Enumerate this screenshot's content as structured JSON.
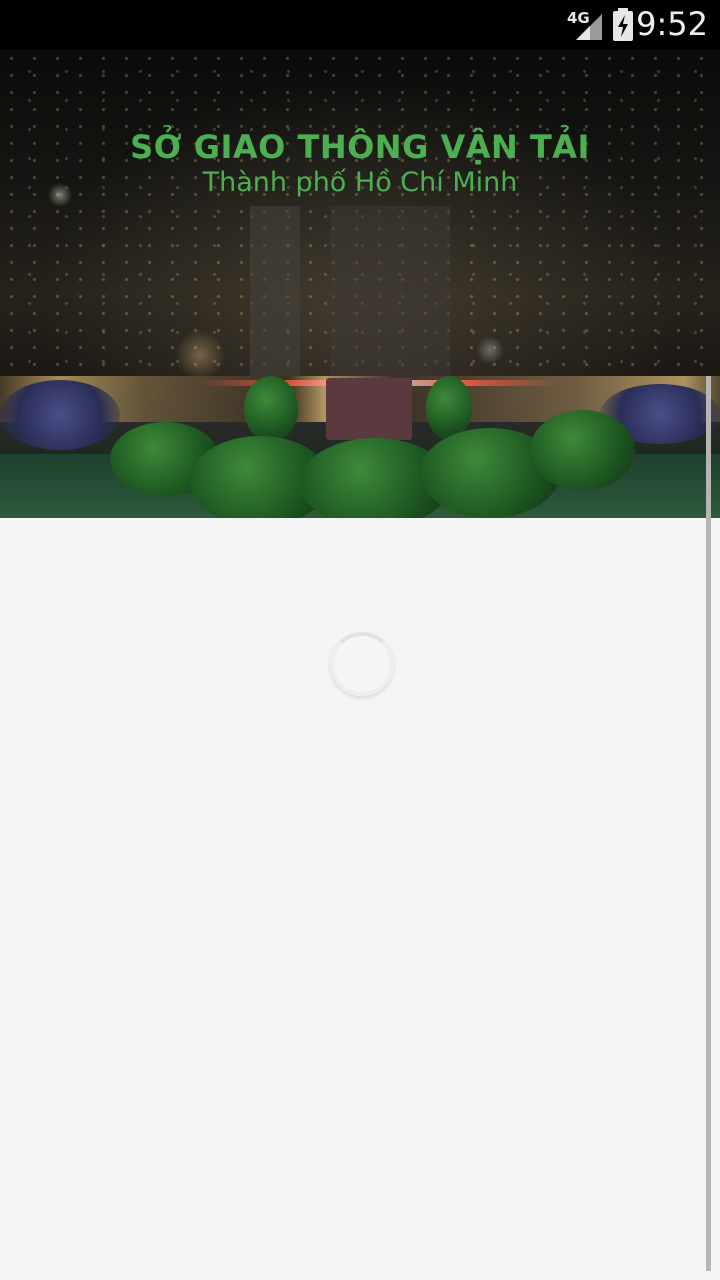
{
  "status_bar": {
    "network": "4G",
    "time": "9:52"
  },
  "header": {
    "title": "SỞ GIAO THÔNG VẬN TẢI",
    "subtitle": "Thành phố Hồ Chí Minh"
  },
  "content": {
    "loading": true
  },
  "colors": {
    "accent": "#4caf50",
    "background": "#f5f5f5",
    "status_bar": "#000000"
  }
}
